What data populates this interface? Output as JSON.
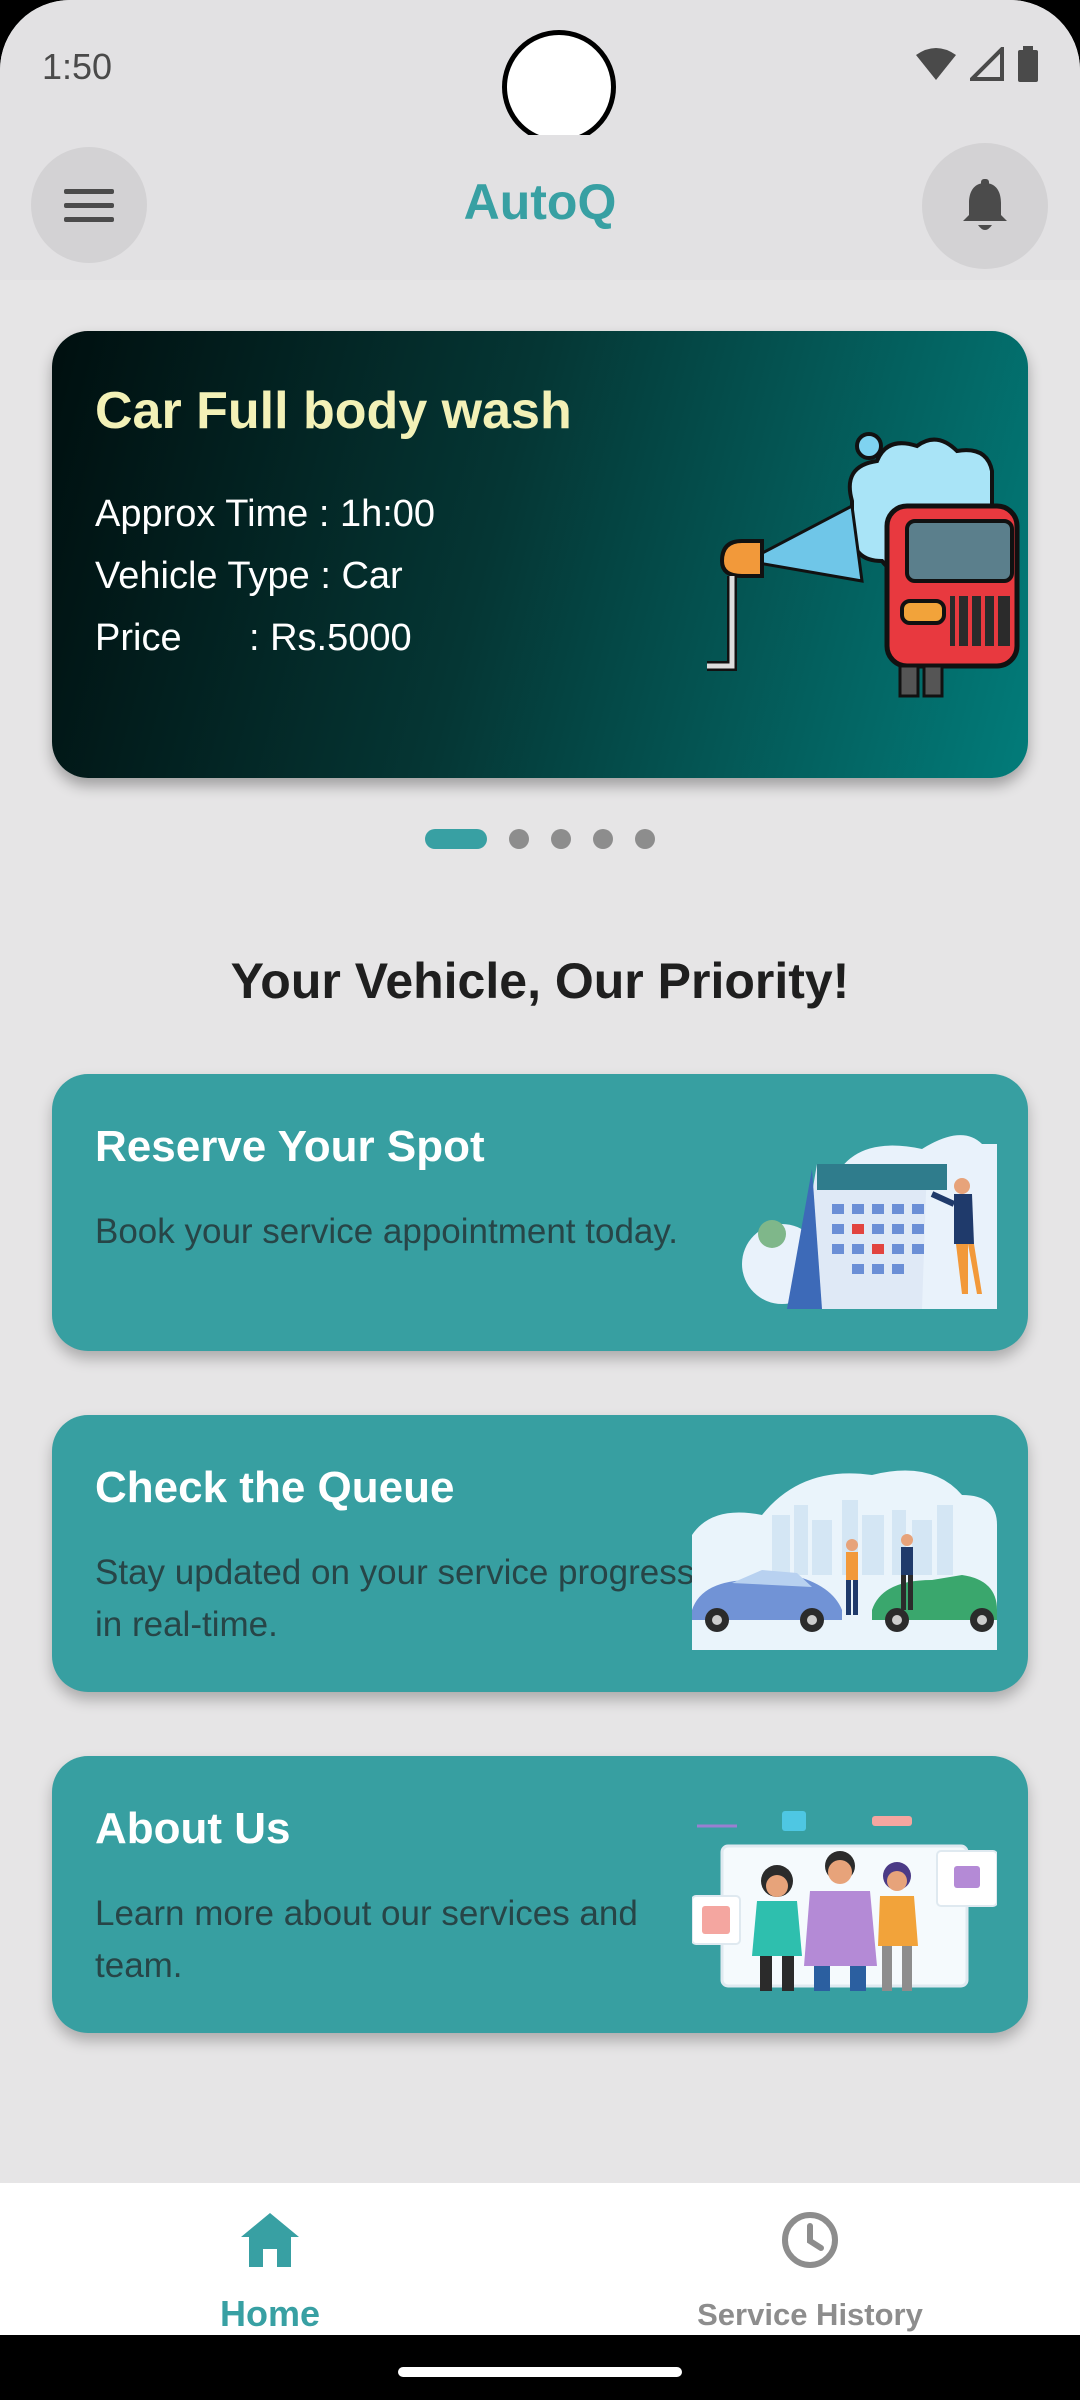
{
  "status_bar": {
    "time": "1:50"
  },
  "app_bar": {
    "title": "AutoQ"
  },
  "carousel": {
    "title": "Car Full body wash",
    "time_line": "Approx Time : 1h:00",
    "vehicle_line": "Vehicle Type : Car",
    "price_label": "Price",
    "price_value": ": Rs.5000",
    "page_count": 5,
    "active_page": 1
  },
  "section_heading": "Your Vehicle, Our Priority!",
  "cards": [
    {
      "title": "Reserve Your Spot",
      "description": "Book your service appointment today.",
      "icon": "calendar-illustration"
    },
    {
      "title": "Check the Queue",
      "description": "Stay updated on your service progress in real-time.",
      "icon": "queue-illustration"
    },
    {
      "title": "About Us",
      "description": "Learn more about our services and team.",
      "icon": "team-illustration"
    }
  ],
  "bottom_nav": {
    "items": [
      {
        "label": "Home",
        "icon": "home-icon",
        "active": true
      },
      {
        "label": "Service History",
        "icon": "clock-icon",
        "active": false
      }
    ]
  },
  "colors": {
    "accent": "#38a0a3",
    "card": "#379fa1",
    "carousel_title": "#f3f1b7",
    "inactive": "#8d8d8d"
  }
}
